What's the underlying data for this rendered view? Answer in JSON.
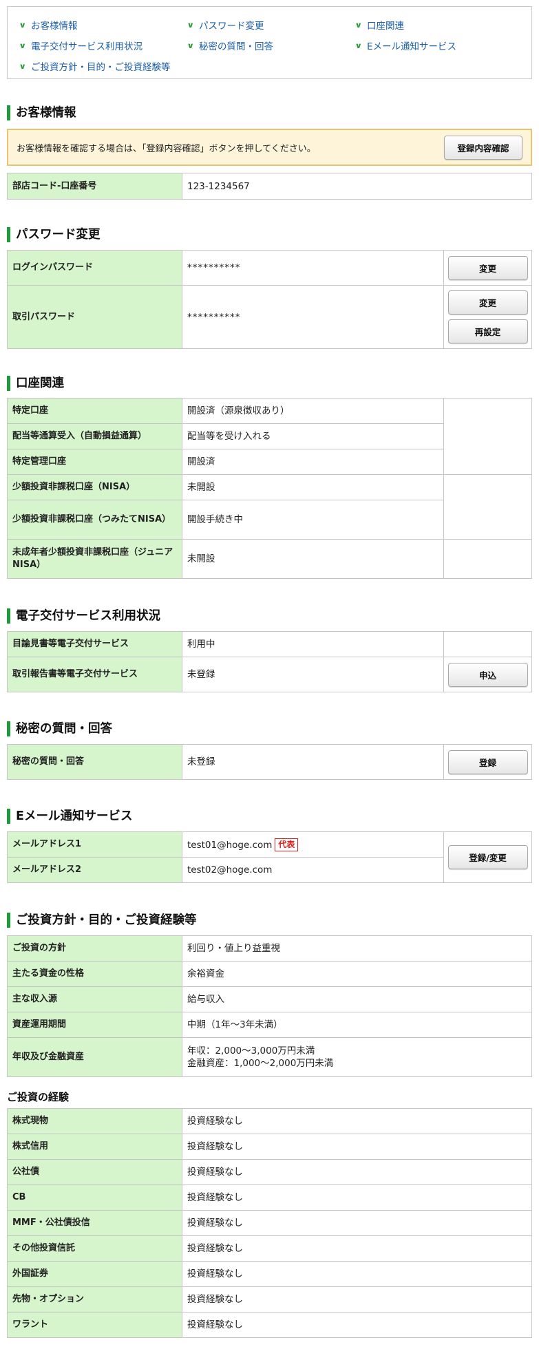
{
  "nav": {
    "items": [
      "お客様情報",
      "パスワード変更",
      "口座関連",
      "電子交付サービス利用状況",
      "秘密の質問・回答",
      "Eメール通知サービス",
      "ご投資方針・目的・ご投資経験等"
    ]
  },
  "customer": {
    "title": "お客様情報",
    "notice": "お客様情報を確認する場合は、「登録内容確認」ボタンを押してください。",
    "confirm_button": "登録内容確認",
    "account_label": "部店コード-口座番号",
    "account_value": "123-1234567"
  },
  "password": {
    "title": "パスワード変更",
    "login_label": "ログインパスワード",
    "login_value": "**********",
    "login_change": "変更",
    "trade_label": "取引パスワード",
    "trade_value": "**********",
    "trade_change": "変更",
    "trade_reset": "再設定"
  },
  "account": {
    "title": "口座関連",
    "rows": [
      {
        "label": "特定口座",
        "value": "開設済（源泉徴収あり）"
      },
      {
        "label": "配当等通算受入（自動損益通算）",
        "value": "配当等を受け入れる"
      },
      {
        "label": "特定管理口座",
        "value": "開設済"
      },
      {
        "label": "少額投資非課税口座（NISA）",
        "value": "未開設"
      },
      {
        "label": "少額投資非課税口座（つみたてNISA）",
        "value": "開設手続き中"
      },
      {
        "label": "未成年者少額投資非課税口座（ジュニアNISA）",
        "value": "未開設"
      }
    ]
  },
  "edelivery": {
    "title": "電子交付サービス利用状況",
    "rows": [
      {
        "label": "目論見書等電子交付サービス",
        "value": "利用中"
      },
      {
        "label": "取引報告書等電子交付サービス",
        "value": "未登録"
      }
    ],
    "apply_button": "申込"
  },
  "secret": {
    "title": "秘密の質問・回答",
    "label": "秘密の質問・回答",
    "value": "未登録",
    "register_button": "登録"
  },
  "email": {
    "title": "Eメール通知サービス",
    "rows": [
      {
        "label": "メールアドレス1",
        "value": "test01@hoge.com"
      },
      {
        "label": "メールアドレス2",
        "value": "test02@hoge.com"
      }
    ],
    "badge": "代表",
    "button": "登録/変更"
  },
  "policy": {
    "title": "ご投資方針・目的・ご投資経験等",
    "rows": [
      {
        "label": "ご投資の方針",
        "value": "利回り・値上り益重視"
      },
      {
        "label": "主たる資金の性格",
        "value": "余裕資金"
      },
      {
        "label": "主な収入源",
        "value": "給与収入"
      },
      {
        "label": "資産運用期間",
        "value": "中期（1年～3年未満）"
      }
    ],
    "income_label": "年収及び金融資産",
    "income_line1": "年収：2,000～3,000万円未満",
    "income_line2": "金融資産：1,000～2,000万円未満"
  },
  "experience": {
    "title": "ご投資の経験",
    "rows": [
      {
        "label": "株式現物",
        "value": "投資経験なし"
      },
      {
        "label": "株式信用",
        "value": "投資経験なし"
      },
      {
        "label": "公社債",
        "value": "投資経験なし"
      },
      {
        "label": "CB",
        "value": "投資経験なし"
      },
      {
        "label": "MMF・公社債投信",
        "value": "投資経験なし"
      },
      {
        "label": "その他投資信託",
        "value": "投資経験なし"
      },
      {
        "label": "外国証券",
        "value": "投資経験なし"
      },
      {
        "label": "先物・オプション",
        "value": "投資経験なし"
      },
      {
        "label": "ワラント",
        "value": "投資経験なし"
      }
    ]
  }
}
